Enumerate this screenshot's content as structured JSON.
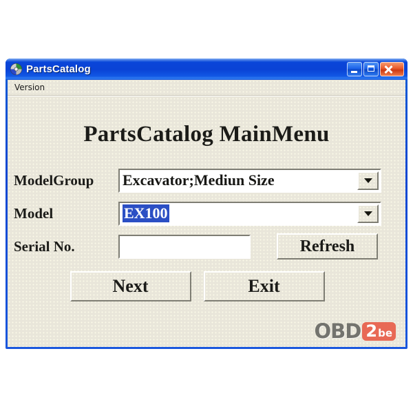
{
  "window": {
    "title": "PartsCatalog",
    "icon": "cd-disc-icon",
    "controls": {
      "minimize_label": "Minimize",
      "maximize_label": "Maximize",
      "close_label": "Close"
    },
    "colors": {
      "title_bar_blue": "#0a45d6",
      "close_button_red": "#e9582a",
      "client_background": "#e9e6da",
      "selection_blue": "#2b4fc4"
    }
  },
  "menu": {
    "items": [
      {
        "label": "Version"
      }
    ]
  },
  "main": {
    "heading": "PartsCatalog MainMenu",
    "fields": [
      {
        "label": "ModelGroup",
        "type": "combobox",
        "value": "Excavator;Mediun Size",
        "selected": false
      },
      {
        "label": "Model",
        "type": "combobox",
        "value": "EX100",
        "selected": true
      },
      {
        "label": "Serial No.",
        "type": "textbox",
        "value": "",
        "placeholder": ""
      }
    ],
    "buttons": {
      "refresh": "Refresh",
      "next": "Next",
      "exit": "Exit"
    }
  },
  "watermark": {
    "primary_text": "OBD",
    "badge_number": "2",
    "badge_suffix": "be",
    "badge_color": "#e8604c"
  }
}
